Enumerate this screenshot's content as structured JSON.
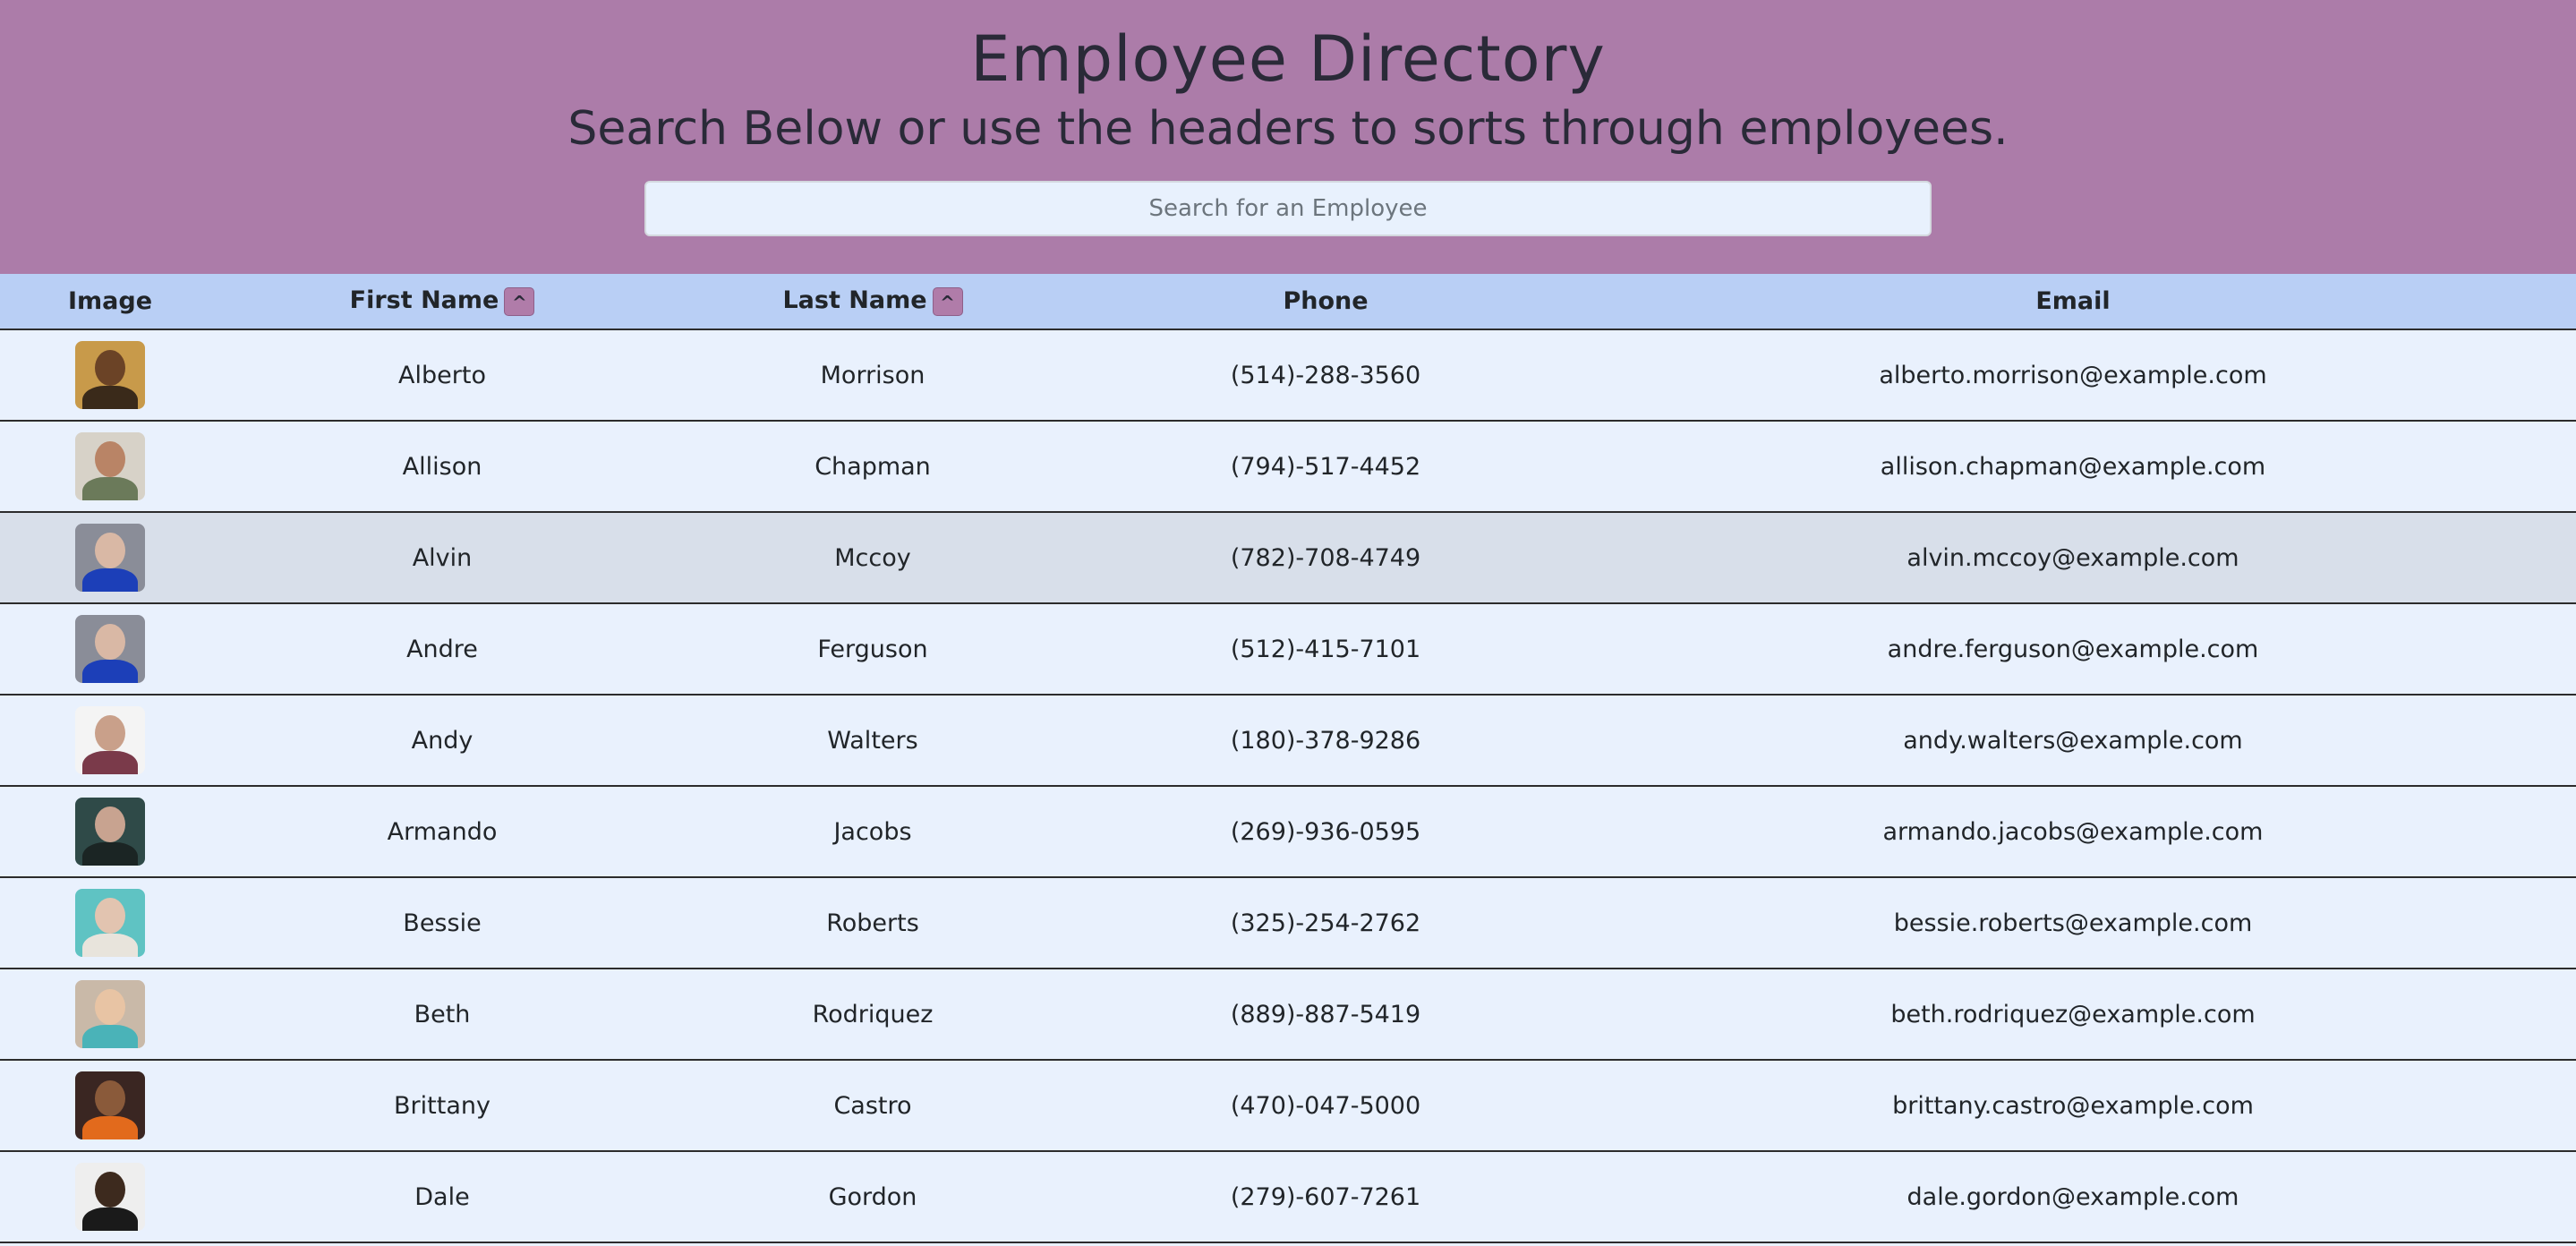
{
  "header": {
    "title": "Employee Directory",
    "subtitle": "Search Below or use the headers to sorts through employees.",
    "search_placeholder": "Search for an Employee"
  },
  "table": {
    "columns": {
      "image": "Image",
      "first": "First Name",
      "last": "Last Name",
      "phone": "Phone",
      "email": "Email"
    },
    "sort_icon": "^",
    "rows": [
      {
        "first": "Alberto",
        "last": "Morrison",
        "phone": "(514)-288-3560",
        "email": "alberto.morrison@example.com",
        "bg": "#c89a4a",
        "skin": "#6b4326",
        "shirt": "#3a2a1a"
      },
      {
        "first": "Allison",
        "last": "Chapman",
        "phone": "(794)-517-4452",
        "email": "allison.chapman@example.com",
        "bg": "#d7d2c8",
        "skin": "#b98466",
        "shirt": "#6b7a5a"
      },
      {
        "first": "Alvin",
        "last": "Mccoy",
        "phone": "(782)-708-4749",
        "email": "alvin.mccoy@example.com",
        "bg": "#8a8d98",
        "skin": "#d9b8a5",
        "shirt": "#1c3fb8"
      },
      {
        "first": "Andre",
        "last": "Ferguson",
        "phone": "(512)-415-7101",
        "email": "andre.ferguson@example.com",
        "bg": "#8a8d98",
        "skin": "#d9b8a5",
        "shirt": "#1c3fb8"
      },
      {
        "first": "Andy",
        "last": "Walters",
        "phone": "(180)-378-9286",
        "email": "andy.walters@example.com",
        "bg": "#f4f4f4",
        "skin": "#c9a08a",
        "shirt": "#7a3a4a"
      },
      {
        "first": "Armando",
        "last": "Jacobs",
        "phone": "(269)-936-0595",
        "email": "armando.jacobs@example.com",
        "bg": "#2f4a48",
        "skin": "#c8a390",
        "shirt": "#1b2524"
      },
      {
        "first": "Bessie",
        "last": "Roberts",
        "phone": "(325)-254-2762",
        "email": "bessie.roberts@example.com",
        "bg": "#5fc3c3",
        "skin": "#e2c4b0",
        "shirt": "#e8e4dc"
      },
      {
        "first": "Beth",
        "last": "Rodriquez",
        "phone": "(889)-887-5419",
        "email": "beth.rodriquez@example.com",
        "bg": "#c9b9a8",
        "skin": "#e8c4a4",
        "shirt": "#4ab3b8"
      },
      {
        "first": "Brittany",
        "last": "Castro",
        "phone": "(470)-047-5000",
        "email": "brittany.castro@example.com",
        "bg": "#3a2622",
        "skin": "#8a5a3a",
        "shirt": "#e26a1c"
      },
      {
        "first": "Dale",
        "last": "Gordon",
        "phone": "(279)-607-7261",
        "email": "dale.gordon@example.com",
        "bg": "#eeeeee",
        "skin": "#3d2a1e",
        "shirt": "#1a1a1a"
      }
    ]
  }
}
